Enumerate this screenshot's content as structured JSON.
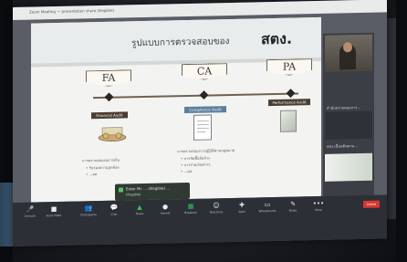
{
  "window": {
    "title": "Zoom Meeting — presentation share (illegible)"
  },
  "slide": {
    "title": "รูปแบบการตรวจสอบของ",
    "title_em": "สตง.",
    "audit_types": [
      {
        "abbr": "FA",
        "label": "Financial Audit",
        "bullets": [
          "การตรวจสอบงบการเงิน",
          "• รับรองความถูกต้อง",
          "• ...ผล"
        ]
      },
      {
        "abbr": "CA",
        "label": "Compliance Audit",
        "bullets": [
          "การตรวจสอบการปฏิบัติตามกฎหมาย",
          "• การจัดซื้อจัดจ้าง",
          "• การจ่ายเงินต่างๆ",
          "• ...ผล"
        ]
      },
      {
        "abbr": "PA",
        "label": "Performance Audit",
        "bullets": []
      }
    ]
  },
  "side_panel": {
    "items": [
      {
        "text": "สำนักตรวจสอบการ..."
      },
      {
        "text": "สตง.เขื่อนติดตาม..."
      }
    ]
  },
  "popup": {
    "title": "Enter Mr. ... (illegible) ...",
    "subtitle": "(illegible)"
  },
  "controls": {
    "buttons": [
      {
        "name": "mute",
        "glyph": "🎤",
        "label": "Unmute"
      },
      {
        "name": "video",
        "glyph": "■",
        "label": "Start Video"
      },
      {
        "name": "participants",
        "glyph": "👥",
        "label": "Participants"
      },
      {
        "name": "chat",
        "glyph": "💬",
        "label": "Chat"
      },
      {
        "name": "share",
        "glyph": "▲",
        "label": "Share"
      },
      {
        "name": "record",
        "glyph": "●",
        "label": "Record"
      },
      {
        "name": "breakout",
        "glyph": "▦",
        "label": "Breakout"
      },
      {
        "name": "reactions",
        "glyph": "☺",
        "label": "Reactions"
      },
      {
        "name": "apps",
        "glyph": "✚",
        "label": "Apps"
      },
      {
        "name": "whiteboards",
        "glyph": "▭",
        "label": "Whiteboards"
      },
      {
        "name": "notes",
        "glyph": "✎",
        "label": "Notes"
      },
      {
        "name": "more",
        "glyph": "•••",
        "label": "More"
      }
    ],
    "leave_label": "Leave",
    "accent_green": "#34c25b",
    "leave_color": "#d6382f"
  }
}
